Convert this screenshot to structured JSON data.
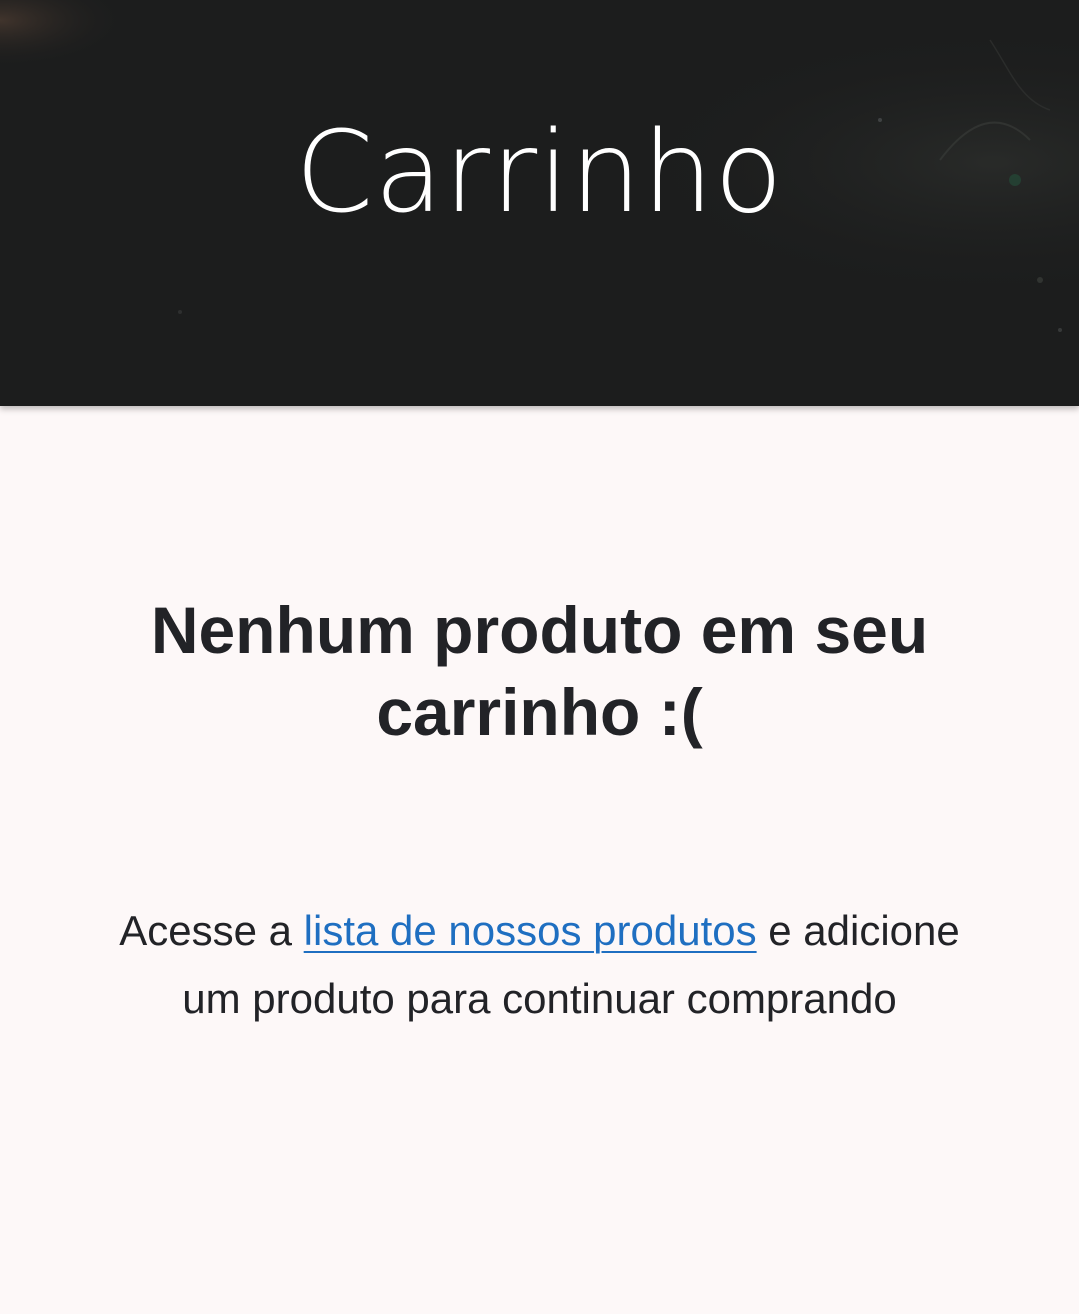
{
  "header": {
    "title": "Carrinho"
  },
  "empty_cart": {
    "heading_line1": "Nenhum produto em seu",
    "heading_line2": "carrinho :(",
    "text_before_link": "Acesse a ",
    "link_label": "lista de nossos produtos",
    "text_after_link": " e adicione",
    "text_line2": "um produto para continuar comprando"
  },
  "colors": {
    "header_background": "#1c1d1d",
    "page_background": "#fdf8f8",
    "text": "#222327",
    "link": "#1f6fc1"
  }
}
